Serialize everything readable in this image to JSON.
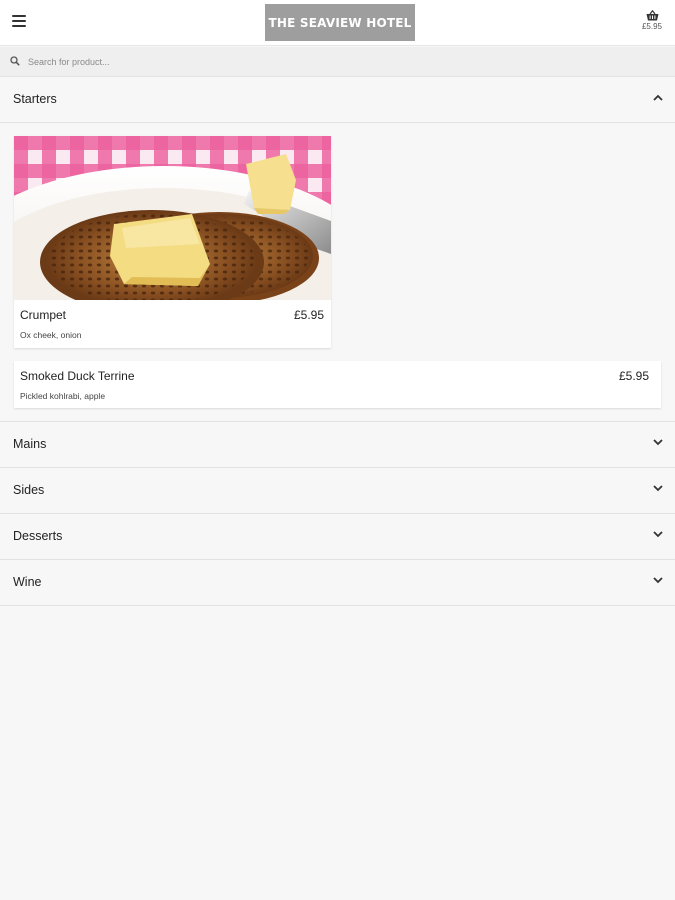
{
  "header": {
    "logo_text": "THE SEAVIEW HOTEL",
    "menu_icon": "hamburger-menu-icon",
    "cart_icon": "basket-icon",
    "cart_total": "£5.95"
  },
  "search": {
    "placeholder": "Search for product...",
    "value": "",
    "icon": "search-icon"
  },
  "categories": [
    {
      "label": "Starters",
      "expanded": true,
      "items": [
        {
          "name": "Crumpet",
          "price": "£5.95",
          "description": "Ox cheek, onion",
          "has_image": true
        },
        {
          "name": "Smoked Duck Terrine",
          "price": "£5.95",
          "description": "Pickled kohlrabi, apple",
          "has_image": false
        }
      ]
    },
    {
      "label": "Mains",
      "expanded": false
    },
    {
      "label": "Sides",
      "expanded": false
    },
    {
      "label": "Desserts",
      "expanded": false
    },
    {
      "label": "Wine",
      "expanded": false
    }
  ],
  "colors": {
    "header_bg": "#ffffff",
    "page_bg": "#f7f7f7",
    "logo_bg": "#9e9e9e",
    "search_bg": "#efefef",
    "tablecloth_pink": "#e8458a"
  }
}
